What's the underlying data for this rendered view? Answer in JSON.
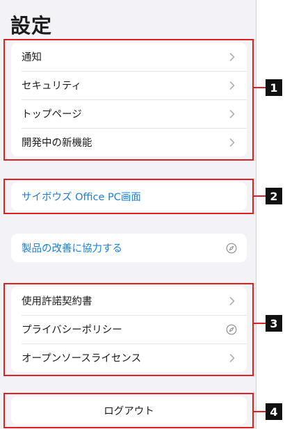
{
  "page_title": "設定",
  "section1": {
    "items": [
      {
        "label": "通知",
        "icon": "chevron-right-icon"
      },
      {
        "label": "セキュリティ",
        "icon": "chevron-right-icon"
      },
      {
        "label": "トップページ",
        "icon": "chevron-right-icon"
      },
      {
        "label": "開発中の新機能",
        "icon": "chevron-right-icon"
      }
    ]
  },
  "section2": {
    "label": "サイボウズ Office PC画面"
  },
  "feedback": {
    "label": "製品の改善に協力する",
    "icon": "compass-icon"
  },
  "section3": {
    "items": [
      {
        "label": "使用許諾契約書",
        "icon": "chevron-right-icon"
      },
      {
        "label": "プライバシーポリシー",
        "icon": "compass-icon"
      },
      {
        "label": "オープンソースライセンス",
        "icon": "chevron-right-icon"
      }
    ]
  },
  "logout": {
    "label": "ログアウト"
  },
  "annotations": [
    "1",
    "2",
    "3",
    "4"
  ],
  "colors": {
    "accent_blue": "#1a80d6",
    "highlight_red": "#e02020",
    "background": "#f2f2f7"
  }
}
